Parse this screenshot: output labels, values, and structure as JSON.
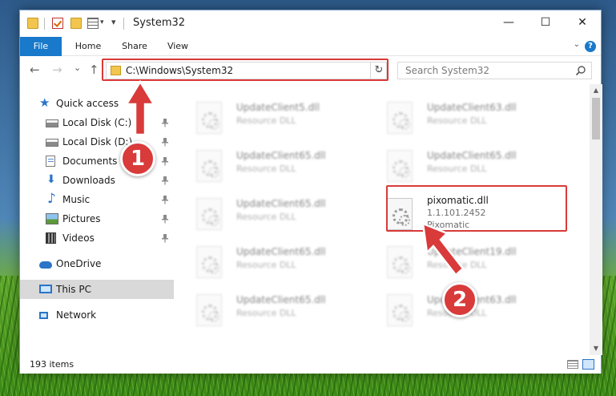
{
  "window": {
    "title": "System32",
    "minimize": "—",
    "maximize": "☐",
    "close": "✕"
  },
  "ribbon": {
    "tabs": [
      "File",
      "Home",
      "Share",
      "View"
    ],
    "help": "?"
  },
  "navbar": {
    "back": "←",
    "forward": "→",
    "recent": "⌄",
    "up": "↑",
    "address": "C:\\Windows\\System32",
    "refresh": "↻",
    "search_placeholder": "Search System32"
  },
  "sidebar": {
    "items": [
      {
        "label": "Quick access",
        "icon": "star-icon",
        "pinned": false,
        "selected": false
      },
      {
        "label": "Local Disk (C:)",
        "icon": "drive-icon",
        "pinned": true,
        "selected": false
      },
      {
        "label": "Local Disk (D:)",
        "icon": "drive-icon",
        "pinned": true,
        "selected": false
      },
      {
        "label": "Documents",
        "icon": "documents-icon",
        "pinned": true,
        "selected": false
      },
      {
        "label": "Downloads",
        "icon": "downloads-icon",
        "pinned": true,
        "selected": false
      },
      {
        "label": "Music",
        "icon": "music-icon",
        "pinned": true,
        "selected": false
      },
      {
        "label": "Pictures",
        "icon": "pictures-icon",
        "pinned": true,
        "selected": false
      },
      {
        "label": "Videos",
        "icon": "videos-icon",
        "pinned": true,
        "selected": false
      },
      {
        "label": "OneDrive",
        "icon": "onedrive-icon",
        "pinned": false,
        "selected": false
      },
      {
        "label": "This PC",
        "icon": "this-pc-icon",
        "pinned": false,
        "selected": true
      },
      {
        "label": "Network",
        "icon": "network-icon",
        "pinned": false,
        "selected": false
      }
    ]
  },
  "files": [
    {
      "name": "UpdateClient5.dll",
      "desc": "Resource DLL",
      "blurred": true
    },
    {
      "name": "UpdateClient63.dll",
      "desc": "Resource DLL",
      "blurred": true
    },
    {
      "name": "UpdateClient65.dll",
      "desc": "Resource DLL",
      "blurred": true
    },
    {
      "name": "UpdateClient65.dll",
      "desc": "Resource DLL",
      "blurred": true
    },
    {
      "name": "UpdateClient65.dll",
      "desc": "Resource DLL",
      "blurred": true
    },
    {
      "name": "pixomatic.dll",
      "version": "1.1.101.2452",
      "desc": "Pixomatic",
      "blurred": false
    },
    {
      "name": "UpdateClient65.dll",
      "desc": "Resource DLL",
      "blurred": true
    },
    {
      "name": "UpdateClient19.dll",
      "desc": "Resource DLL",
      "blurred": true
    },
    {
      "name": "UpdateClient65.dll",
      "desc": "Resource DLL",
      "blurred": true
    },
    {
      "name": "UpdateClient63.dll",
      "desc": "Resource DLL",
      "blurred": true
    }
  ],
  "status": {
    "item_count": "193 items"
  },
  "callouts": [
    "1",
    "2"
  ],
  "colors": {
    "accent": "#1979ca",
    "highlight": "#d93a3a",
    "selected_nav": "#d9d9d9"
  }
}
